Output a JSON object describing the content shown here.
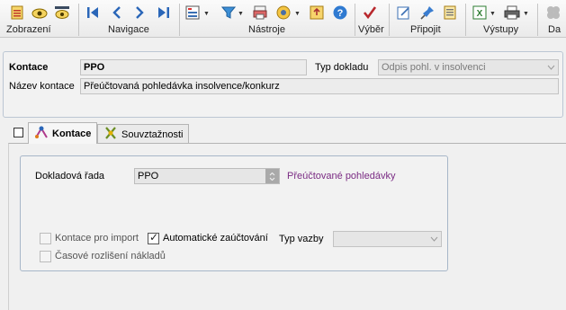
{
  "toolbar": {
    "groups": [
      {
        "label": "Zobrazení"
      },
      {
        "label": "Navigace"
      },
      {
        "label": "Nástroje"
      },
      {
        "label": "Výběr"
      },
      {
        "label": "Připojit"
      },
      {
        "label": "Výstupy"
      },
      {
        "label": "Da"
      }
    ],
    "icons": {
      "first": "⏮",
      "prev": "❮",
      "next": "❯",
      "last": "⏭"
    }
  },
  "header": {
    "kontace_label": "Kontace",
    "kontace_value": "PPO",
    "typ_dokladu_label": "Typ dokladu",
    "typ_dokladu_value": "Odpis pohl. v insolvenci",
    "nazev_label": "Název kontace",
    "nazev_value": "Přeúčtovaná pohledávka insolvence/konkurz"
  },
  "tabs": [
    {
      "label": "Kontace",
      "active": true
    },
    {
      "label": "Souvztažnosti",
      "active": false
    }
  ],
  "detail": {
    "rada_label": "Dokladová řada",
    "rada_value": "PPO",
    "rada_description": "Přeúčtované pohledávky",
    "import_label": "Kontace pro import",
    "import_checked": false,
    "auto_label": "Automatické zaúčtování",
    "auto_checked": true,
    "typ_vazby_label": "Typ vazby",
    "typ_vazby_value": "",
    "casove_label": "Časové rozlišení nákladů",
    "casove_checked": false
  },
  "colors": {
    "accent": "#1f5fb0",
    "description": "#7a2b83"
  }
}
